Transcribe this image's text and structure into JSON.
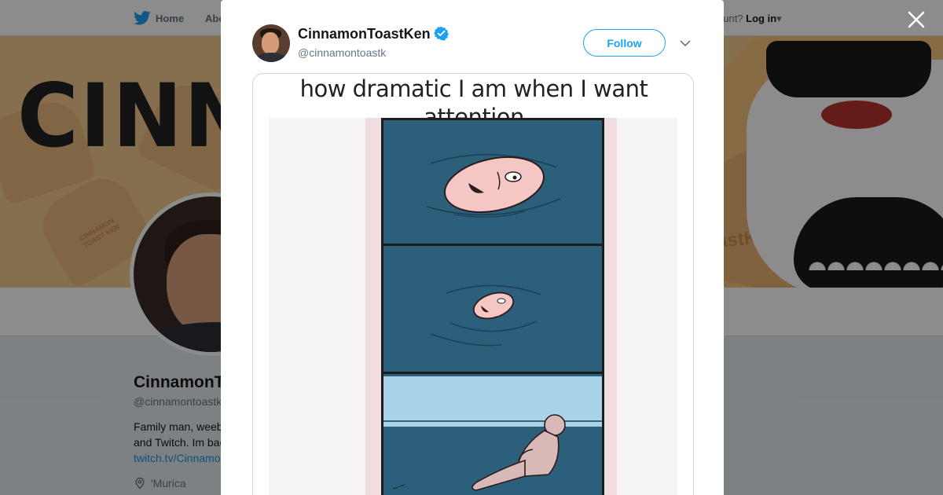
{
  "background_page": {
    "nav": {
      "home_label": "Home",
      "about_label": "Abo",
      "account_prefix": "ccount?",
      "login_label": "Log in"
    },
    "banner": {
      "text_left": "CINNA",
      "text_right": "astKen",
      "toast_label": "CINNAMON TOAST KEN"
    },
    "profile": {
      "name": "CinnamonT",
      "handle": "@cinnamontoastk",
      "bio_line1": "Family man, weeb",
      "bio_line2": "and Twitch. Im bac",
      "bio_link": "twitch.tv/Cinnamo",
      "location": "'Murica"
    }
  },
  "modal": {
    "author": {
      "name": "CinnamonToastKen",
      "handle": "@cinnamontoastk",
      "verified": true
    },
    "follow_label": "Follow",
    "media": {
      "caption": "how dramatic I am when I want attention",
      "panels": [
        "face-floating-in-water",
        "face-sinking",
        "person-sitting-on-shore"
      ]
    }
  },
  "colors": {
    "accent": "#1da1f2",
    "overlay": "rgba(0,0,0,0.45)",
    "comic_water": "#2b5f7a",
    "comic_sky": "#a9d3e6"
  },
  "icons": {
    "nav_home": "twitter-bird-icon",
    "close": "close-icon",
    "chevron": "chevron-down-icon",
    "verified": "verified-badge-icon",
    "location": "location-pin-icon"
  }
}
